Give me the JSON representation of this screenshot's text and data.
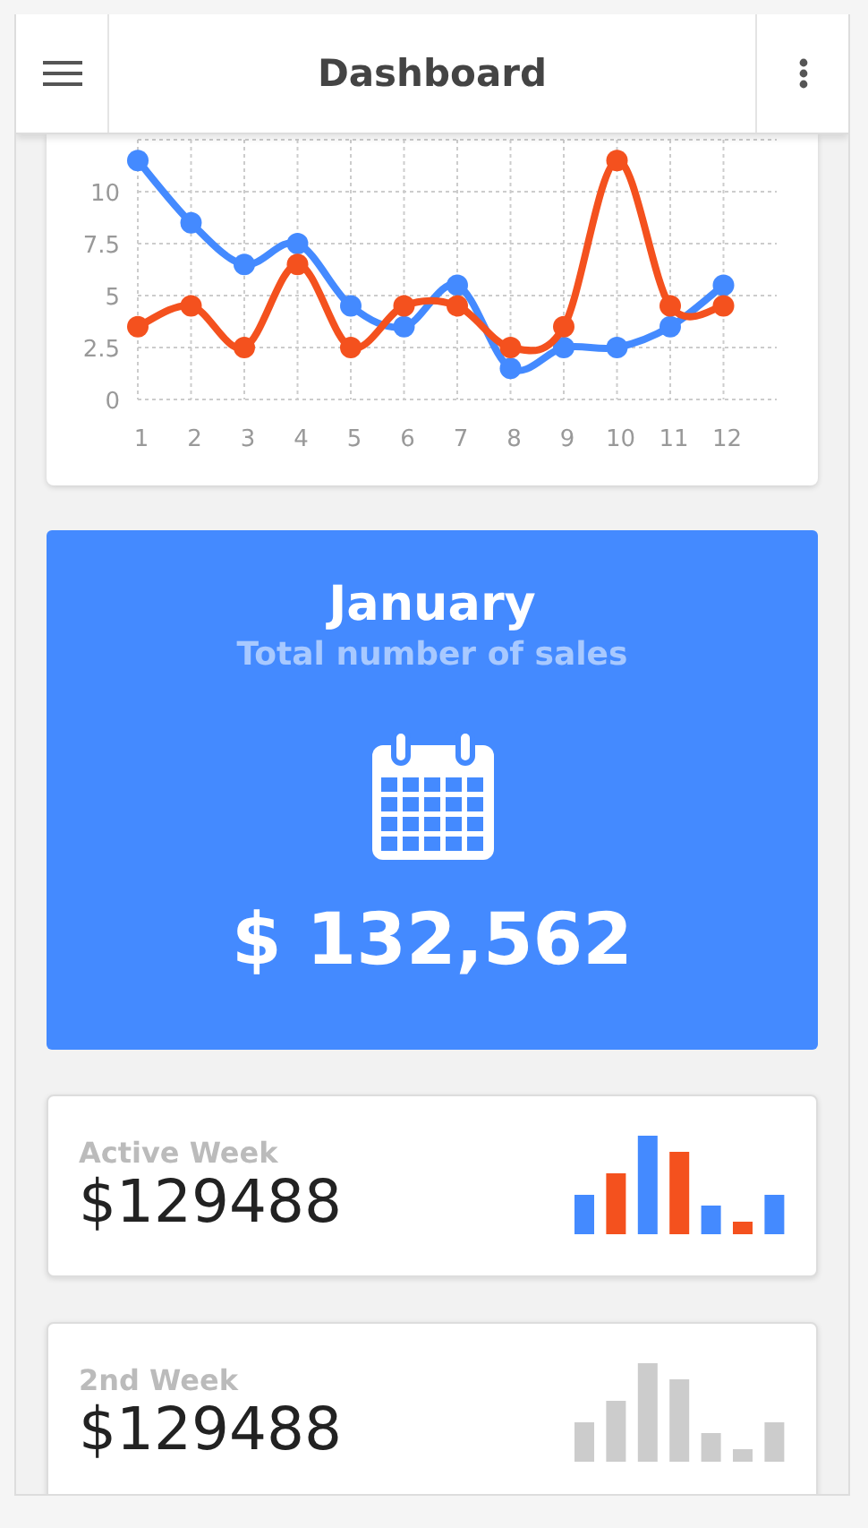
{
  "header": {
    "title": "Dashboard"
  },
  "chart": {
    "chart_data": {
      "type": "line",
      "x": [
        1,
        2,
        3,
        4,
        5,
        6,
        7,
        8,
        9,
        10,
        11,
        12
      ],
      "xlim": [
        1,
        13
      ],
      "ylim": [
        0,
        12.5
      ],
      "grid": true,
      "yticks": [
        0,
        2.5,
        5,
        7.5,
        10
      ],
      "xticks": [
        1,
        2,
        3,
        4,
        5,
        6,
        7,
        8,
        9,
        10,
        11,
        12
      ],
      "series": [
        {
          "marker": true,
          "color": "#448aff",
          "values": [
            11.5,
            8.5,
            6.5,
            7.5,
            4.5,
            3.5,
            5.5,
            1.5,
            2.5,
            2.5,
            3.5,
            5.5
          ]
        },
        {
          "marker": true,
          "color": "#f4511e",
          "values": [
            3.5,
            4.5,
            2.5,
            6.5,
            2.5,
            4.5,
            4.5,
            2.5,
            3.5,
            11.5,
            4.5,
            4.5
          ]
        }
      ]
    }
  },
  "month_card": {
    "title": "January",
    "subtitle": "Total number of sales",
    "amount": "$ 132,562"
  },
  "week_cards": [
    {
      "label": "Active Week",
      "amount": "$129488",
      "active": true
    },
    {
      "label": "2nd Week",
      "amount": "$129488",
      "active": false
    }
  ]
}
